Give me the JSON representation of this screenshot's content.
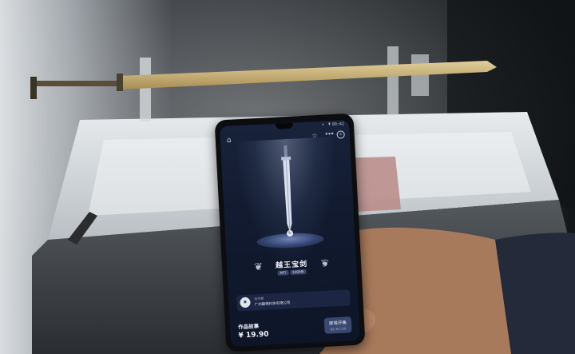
{
  "phone": {
    "status_time": "09:42",
    "status_icons": "▴ ▮",
    "icons": {
      "home": "home-icon",
      "favorite": "star-icon",
      "menu": "more-icon",
      "close": "close-icon"
    },
    "artwork_title": "越王宝剑",
    "badge_left": "NFT",
    "badge_right": "1000份",
    "creator_role": "创作者",
    "creator_org": "广州趣棋科技有限公司",
    "story_label": "作品故事",
    "price": "¥ 19.90",
    "sale_label": "即将开售",
    "sale_time": "02:07:59"
  },
  "colors": {
    "screen_bg": "#111a2e",
    "accent": "#3a4870",
    "sword_gold": "#c9b178"
  }
}
